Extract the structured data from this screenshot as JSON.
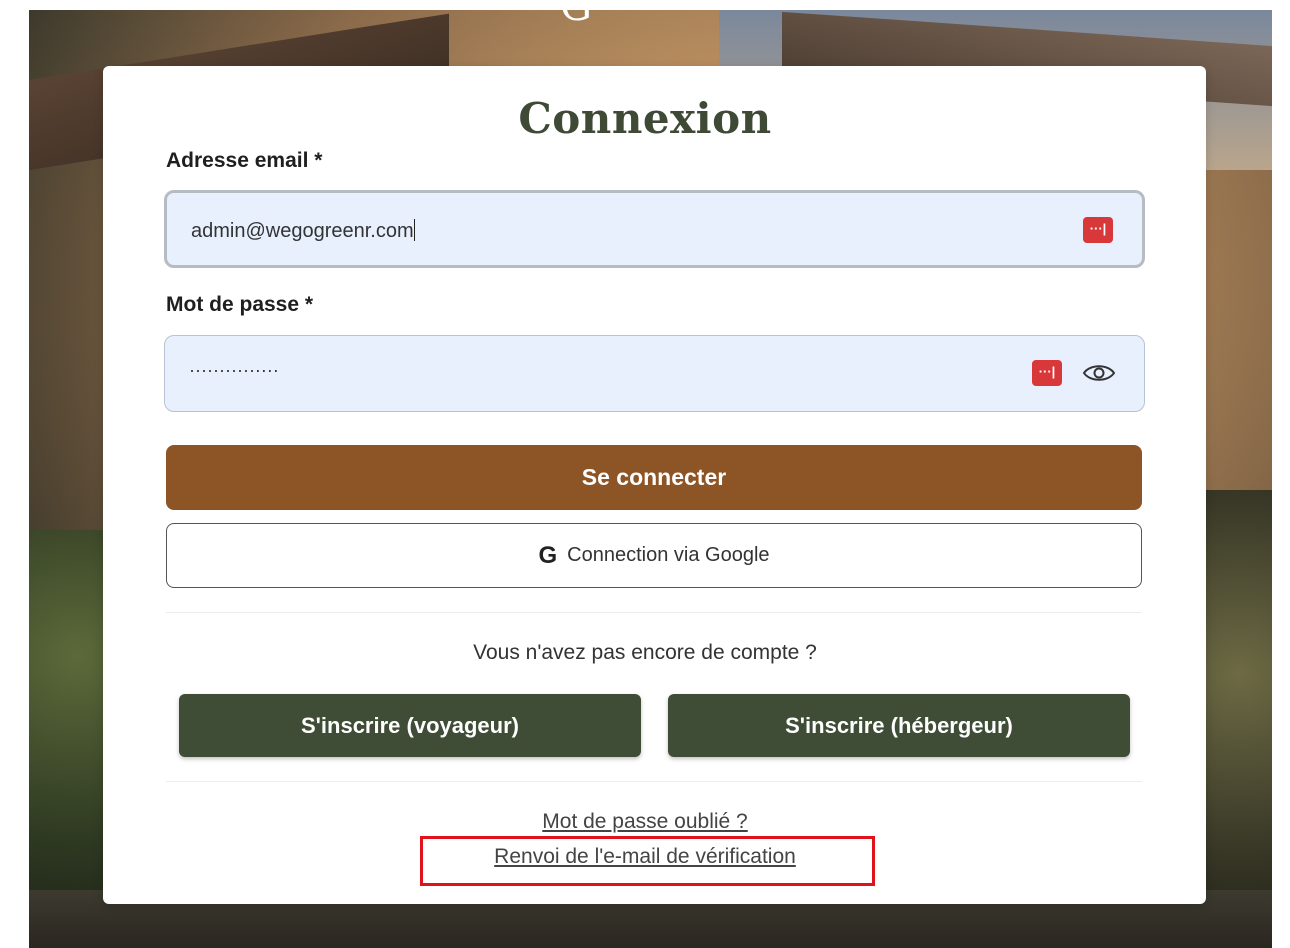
{
  "logo_fragment": "G",
  "form": {
    "title": "Connexion",
    "email": {
      "label": "Adresse email *",
      "value": "admin@wegogreenr.com",
      "password_manager_icon": "password-manager-icon"
    },
    "password": {
      "label": "Mot de passe *",
      "value": "···············",
      "password_manager_icon": "password-manager-icon",
      "visibility_icon": "eye-icon"
    },
    "login_button": "Se connecter",
    "google_button": {
      "icon_glyph": "G",
      "label": "Connection via Google"
    },
    "no_account_text": "Vous n'avez pas encore de compte ?",
    "signup_traveler": "S'inscrire (voyageur)",
    "signup_host": "S'inscrire (hébergeur)",
    "forgot_password": "Mot de passe oublié ?",
    "resend_verification": "Renvoi de l'e-mail de vérification"
  },
  "colors": {
    "primary_button": "#8d5526",
    "signup_button": "#3f4d37",
    "title": "#3e4a35",
    "field_background": "#e8f0fe",
    "highlight": "#e1131a"
  }
}
